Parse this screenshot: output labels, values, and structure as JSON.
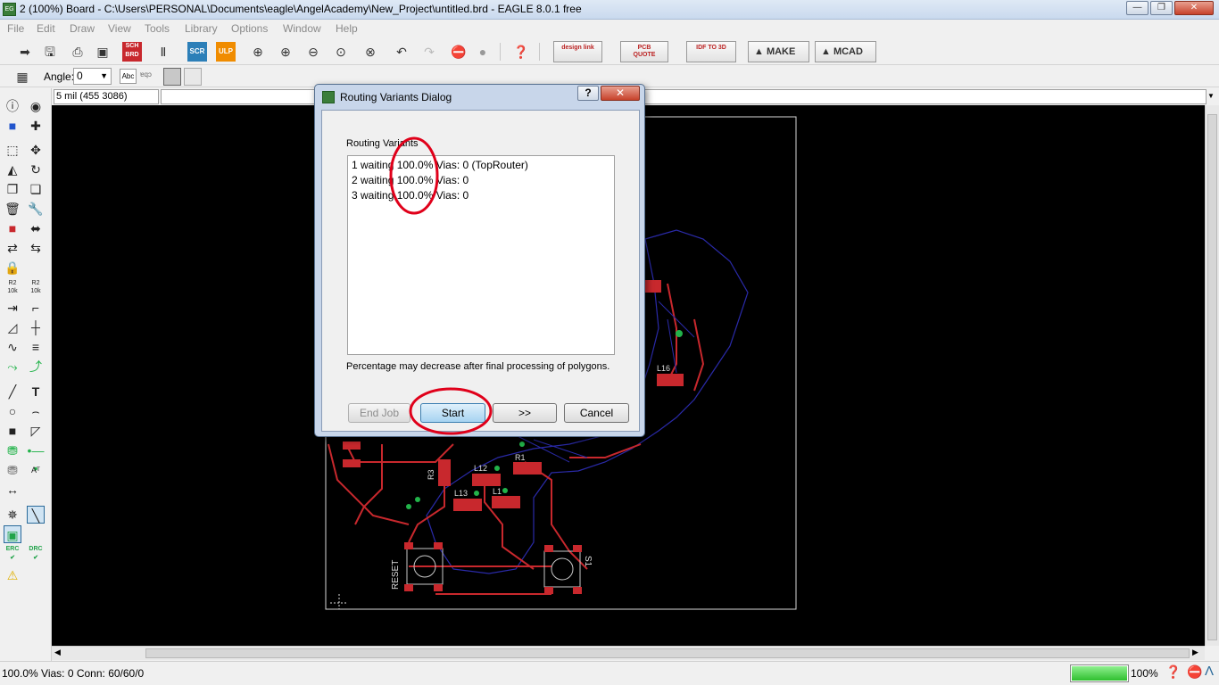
{
  "window": {
    "title": "2 (100%) Board - C:\\Users\\PERSONAL\\Documents\\eagle\\AngelAcademy\\New_Project\\untitled.brd - EAGLE 8.0.1 free",
    "minimize": "—",
    "maximize": "❐",
    "close": "✕"
  },
  "menu": [
    "File",
    "Edit",
    "Draw",
    "View",
    "Tools",
    "Library",
    "Options",
    "Window",
    "Help"
  ],
  "toolbar": {
    "sch_brd": "SCH BRD",
    "scr": "SCR",
    "ulp": "ULP",
    "design_link": "design link",
    "pcb_quote": "PCB QUOTE",
    "idf_to_3d": "IDF TO 3D",
    "make": "MAKE",
    "mcad": "MCAD"
  },
  "parambar": {
    "angle_label": "Angle:",
    "angle_value": "0",
    "abc_label": "Abc",
    "abc_mirror": "ɐqɔ"
  },
  "coords": {
    "value": "5 mil (455 3086)"
  },
  "dialog": {
    "title": "Routing Variants Dialog",
    "help": "?",
    "close": "✕",
    "list_label": "Routing Variants",
    "variants": [
      "1 waiting  100.0% Vias: 0 (TopRouter)",
      "2 waiting  100.0% Vias: 0",
      "3 waiting  100.0% Vias: 0"
    ],
    "note": "Percentage may decrease after final processing of polygons.",
    "end_job": "End Job",
    "start": "Start",
    "next": ">>",
    "cancel": "Cancel"
  },
  "board": {
    "labels": [
      "L16",
      "L12",
      "R1",
      "R3",
      "L13",
      "L1",
      "RESET",
      "S1"
    ]
  },
  "status": {
    "text": "100.0%  Vias: 0  Conn: 60/60/0",
    "progress_percent": 100,
    "progress_label": "100%"
  },
  "colors": {
    "canvas": "#000000",
    "trace": "#c8282d",
    "airwire": "#2a2aa8",
    "via": "#22b34a",
    "highlight": "#e0001a",
    "progress": "#3fd33f"
  }
}
